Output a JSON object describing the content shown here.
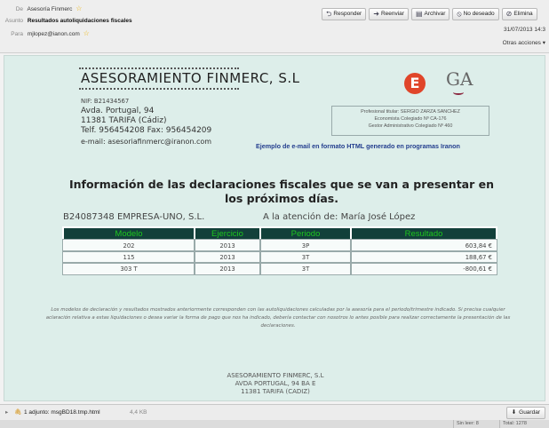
{
  "header": {
    "from_label": "De",
    "from_value": "Asesoría Finmerc",
    "subject_label": "Asunto",
    "subject_value": "Resultados autoliquidaciones fiscales",
    "to_label": "Para",
    "to_value": "mjlopez@ianon.com",
    "date": "31/07/2013 14:3",
    "other_actions": "Otras acciones ▾",
    "toolbar": [
      {
        "icon": "reply-icon",
        "glyph": "⮌",
        "label": "Responder"
      },
      {
        "icon": "forward-icon",
        "glyph": "➜",
        "label": "Reenviar"
      },
      {
        "icon": "archive-icon",
        "glyph": "▤",
        "label": "Archivar"
      },
      {
        "icon": "junk-icon",
        "glyph": "⦸",
        "label": "No deseado"
      },
      {
        "icon": "delete-icon",
        "glyph": "⊘",
        "label": "Elimina"
      }
    ]
  },
  "company": {
    "name": "ASESORAMIENTO FINMERC, S.L",
    "nif": "NIF: B21434567",
    "address_line1": "Avda. Portugal, 94",
    "address_line2": "11381 TARIFA  (Cádiz)",
    "phones": "Telf. 956454208   Fax: 956454209",
    "email": "e-mail: asesoriafinmerc@iranon.com",
    "logo_letter": "E",
    "logo_ga": "GA"
  },
  "professional": {
    "line1": "Profesional titular: SERGIO ZARZA SANCHEZ",
    "line2": "Economista Colegiado Nº CA-176",
    "line3": "Gestor Administrativo Colegiado Nº 460"
  },
  "example_note": "Ejemplo de e-mail en formato HTML generado en programas Iranon",
  "title": "Información de las declaraciones fiscales que se van a presentar en los próximos días.",
  "client": "B24087348 EMPRESA-UNO, S.L.",
  "attention": "A la atención de: María José López",
  "table": {
    "headers": [
      "Modelo",
      "Ejercicio",
      "Periodo",
      "Resultado"
    ],
    "rows": [
      [
        "202",
        "2013",
        "3P",
        "603,84 €"
      ],
      [
        "115",
        "2013",
        "3T",
        "188,67 €"
      ],
      [
        "303 T",
        "2013",
        "3T",
        "-800,61 €"
      ]
    ]
  },
  "note": "Los modelos de declaración y resultados mostrados anteriormente corresponden con las autoliquidaciones calculadas por la asesoría para el periodo/trimestre indicado. Si precisa cualquier aclaración relativa a estas liquidaciones o desea variar la forma de pago que nos ha indicado, debería contactar con nosotros lo antes posible para realizar correctamente la presentación de las declaraciones.",
  "footer": {
    "name": "ASESORAMIENTO FINMERC, S.L",
    "line1": "AVDA PORTUGAL, 94 BA E",
    "line2": "11381 TARIFA (CADIZ)"
  },
  "attachment": {
    "label": "1 adjunto: msgBD18.tmp.html",
    "size": "4,4 KB",
    "save_label": "Guardar"
  },
  "status": {
    "seg1": "Sin leer: 8",
    "seg2": "Total: 1278"
  }
}
